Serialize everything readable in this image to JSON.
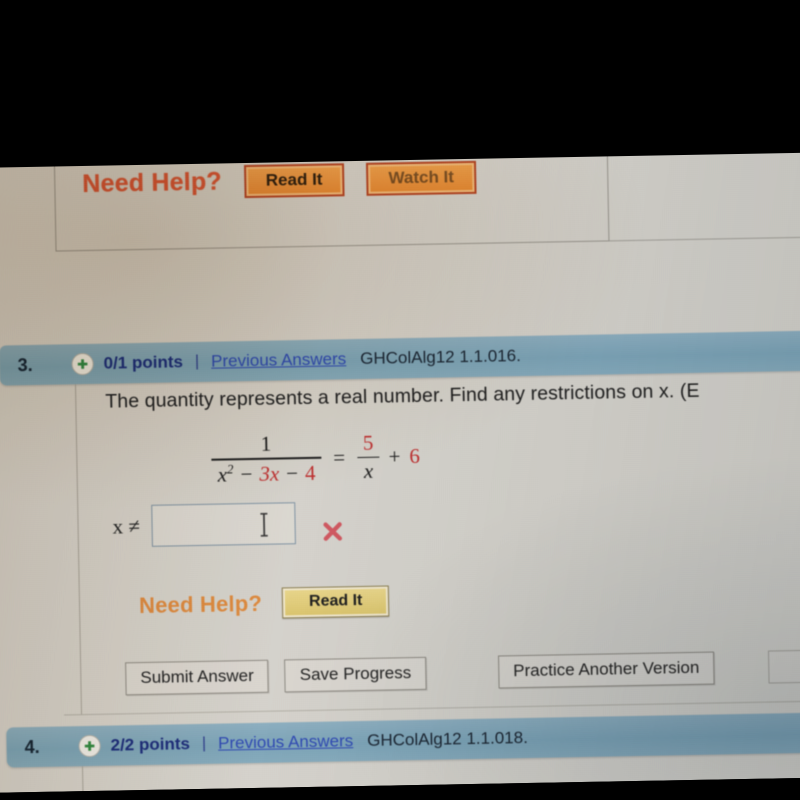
{
  "photo": {
    "description": "photograph of a computer monitor showing an online math homework page",
    "letterbox_color": "#000000",
    "screen_background": "#d8d5ce"
  },
  "upper_question": {
    "need_help_label": "Need Help?",
    "buttons": [
      {
        "label": "Read It",
        "clipped": false
      },
      {
        "label": "Watch It",
        "clipped": true
      }
    ]
  },
  "question3": {
    "number": "3.",
    "plus_icon": "plus-icon",
    "points": "0/1 points",
    "separator": "|",
    "previous_answers": "Previous Answers",
    "code": "GHColAlg12 1.1.016.",
    "prompt": "The quantity represents a real number. Find any restrictions on x. (E",
    "equation": {
      "left_fraction": {
        "numerator": "1",
        "denominator_parts": [
          {
            "text": "x",
            "style": "italic",
            "color": "#141414",
            "sup": "2"
          },
          {
            "text": "−",
            "style": "op",
            "color": "#141414"
          },
          {
            "text": "3x",
            "style": "italic",
            "color": "#c02a2a"
          },
          {
            "text": "−",
            "style": "op",
            "color": "#141414"
          },
          {
            "text": "4",
            "style": "plain",
            "color": "#c02a2a"
          }
        ]
      },
      "equals": "=",
      "right_fraction": {
        "numerator": "5",
        "numerator_color": "#c02a2a",
        "denominator": "x",
        "denominator_color": "#141414"
      },
      "plus": "+",
      "addend": "6",
      "addend_color": "#c02a2a"
    },
    "answer": {
      "label": "x ≠",
      "value": "",
      "placeholder": "",
      "cursor_icon": "text-cursor-icon",
      "result_icon": "incorrect-x-icon",
      "result_color": "#d2565f"
    },
    "need_help_label": "Need Help?",
    "read_it_label": "Read It",
    "actions": [
      {
        "label": "Submit Answer",
        "clipped": false
      },
      {
        "label": "Save Progress",
        "clipped": false
      },
      {
        "label": "Practice Another Version",
        "clipped": false
      }
    ]
  },
  "question4": {
    "number": "4.",
    "plus_icon": "plus-icon",
    "points": "2/2 points",
    "separator": "|",
    "previous_answers": "Previous Answers",
    "code": "GHColAlg12 1.1.018."
  },
  "colors": {
    "header_bar": "#7ca5b9",
    "points_text": "#19297a",
    "link_text": "#2b46b4",
    "need_help_orange": "#e08a3c",
    "need_help_red_orange": "#d9552f",
    "math_red": "#c02a2a",
    "incorrect_red": "#d2565f",
    "page_bg": "#d8d5ce"
  }
}
